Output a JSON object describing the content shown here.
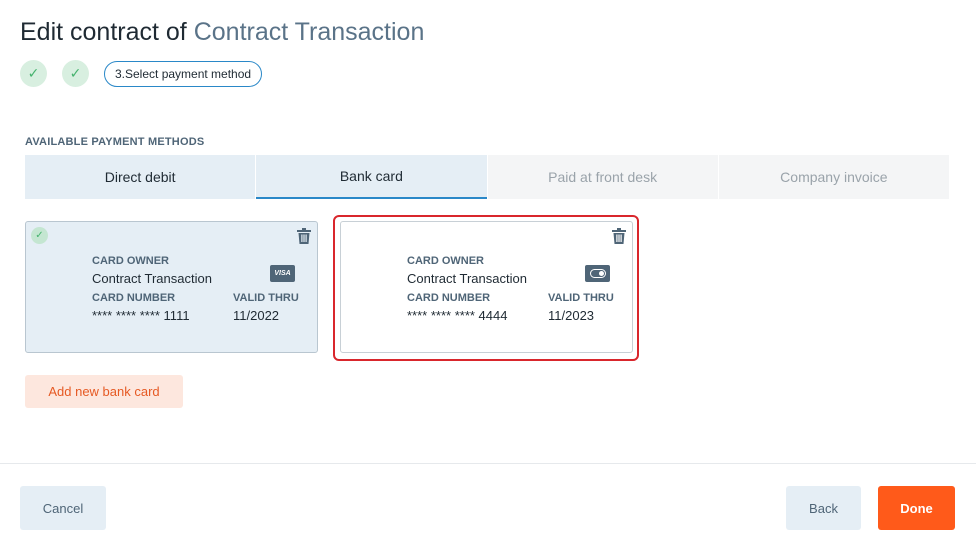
{
  "header": {
    "title_prefix": "Edit contract of",
    "title_name": "Contract Transaction"
  },
  "stepper": {
    "completed_icon": "checkmark-icon",
    "current_step_label": "3.Select payment method"
  },
  "payment": {
    "section_label": "AVAILABLE PAYMENT METHODS",
    "tabs": [
      {
        "label": "Direct debit",
        "state": "enabled"
      },
      {
        "label": "Bank card",
        "state": "active"
      },
      {
        "label": "Paid at front desk",
        "state": "disabled"
      },
      {
        "label": "Company invoice",
        "state": "disabled"
      }
    ],
    "cards": [
      {
        "selected": true,
        "owner_label": "CARD OWNER",
        "owner": "Contract Transaction",
        "brand": "VISA",
        "number_label": "CARD NUMBER",
        "number": "**** **** **** 1111",
        "valid_label": "VALID THRU",
        "valid": "11/2022"
      },
      {
        "selected": false,
        "owner_label": "CARD OWNER",
        "owner": "Contract Transaction",
        "brand_icon": "card-brand-icon",
        "number_label": "CARD NUMBER",
        "number": "**** **** **** 4444",
        "valid_label": "VALID THRU",
        "valid": "11/2023"
      }
    ],
    "add_card_label": "Add new bank card"
  },
  "footer": {
    "cancel_label": "Cancel",
    "back_label": "Back",
    "done_label": "Done"
  },
  "colors": {
    "accent_blue": "#2a88c8",
    "primary_orange": "#ff5a1a",
    "highlight_red": "#d9262c",
    "success_green": "#46b36e"
  }
}
